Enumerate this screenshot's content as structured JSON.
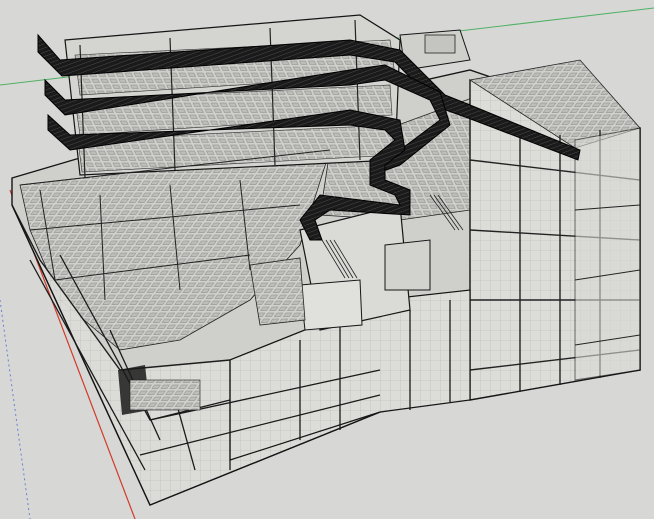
{
  "viewport": {
    "background": "#d7d7d5",
    "axis_colors": {
      "red": "#d23a2a",
      "green": "#2fa84a",
      "blue": "#3a5bd6"
    },
    "model_colors": {
      "slab": "#c9c9c6",
      "slab_light": "#d4d4d1",
      "grid_line": "#8a8a88",
      "edge": "#151515",
      "ribbon": "#111111",
      "glass": "#e2e2df"
    }
  },
  "model": {
    "description_icon": "3d-building-model-icon"
  }
}
